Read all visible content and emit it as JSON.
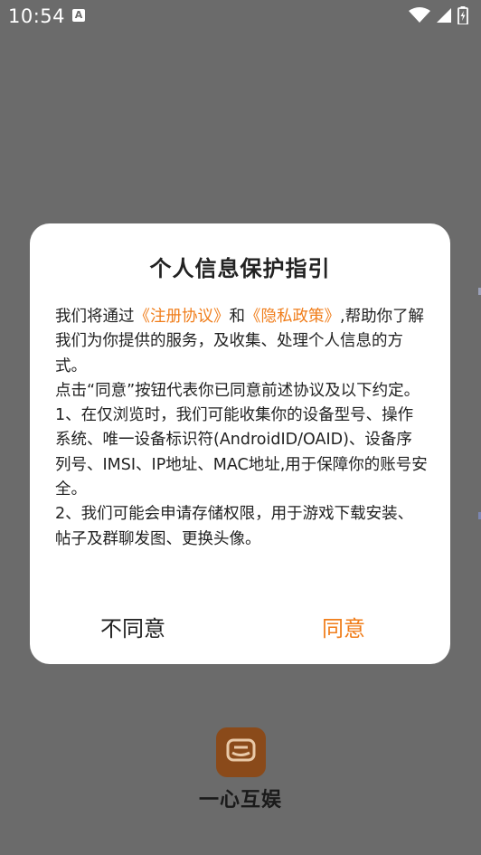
{
  "status_bar": {
    "time": "10:54",
    "notification_letter": "A",
    "icons": [
      "wifi-icon",
      "signal-icon",
      "battery-icon"
    ]
  },
  "dialog": {
    "title": "个人信息保护指引",
    "paragraph1": {
      "prefix": "我们将通过",
      "link_terms": "《注册协议》",
      "middle": "和",
      "link_privacy": "《隐私政策》",
      "suffix": ",帮助你了解我们为你提供的服务，及收集、处理个人信息的方式。"
    },
    "paragraph2": "点击“同意”按钮代表你已同意前述协议及以下约定。",
    "paragraph3": "1、在仅浏览时，我们可能收集你的设备型号、操作系统、唯一设备标识符(AndroidID/OAID)、设备序列号、IMSI、IP地址、MAC地址,用于保障你的账号安全。",
    "paragraph4": "2、我们可能会申请存储权限，用于游戏下载安装、帖子及群聊发图、更换头像。",
    "disagree_label": "不同意",
    "agree_label": "同意"
  },
  "app": {
    "name": "一心互娱"
  },
  "colors": {
    "accent": "#f07d1a",
    "overlay": "#6b6b6b",
    "logo": "#8a4a1a"
  }
}
